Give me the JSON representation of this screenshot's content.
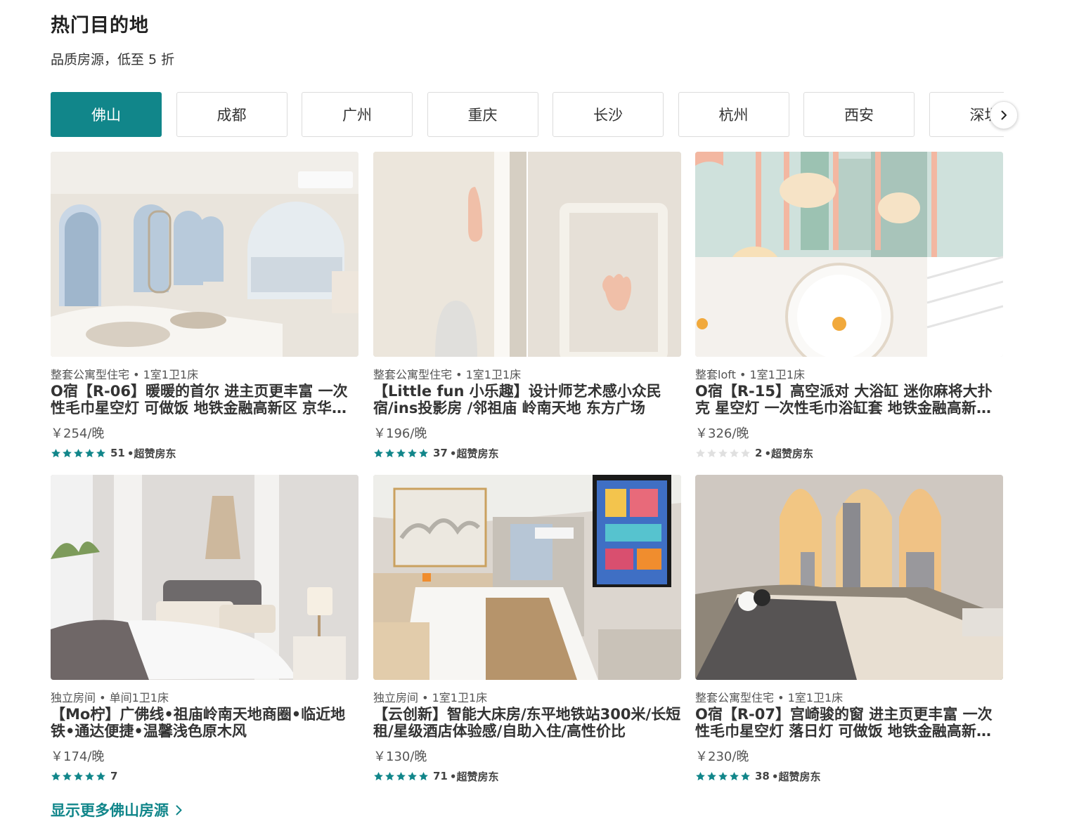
{
  "section": {
    "title": "热门目的地",
    "subtitle": "品质房源，低至 5 折"
  },
  "tabs": [
    {
      "label": "佛山",
      "active": true
    },
    {
      "label": "成都"
    },
    {
      "label": "广州"
    },
    {
      "label": "重庆"
    },
    {
      "label": "长沙"
    },
    {
      "label": "杭州"
    },
    {
      "label": "西安"
    },
    {
      "label": "深圳"
    }
  ],
  "next_icon": "chevron-right-icon",
  "listings": [
    {
      "meta": "整套公寓型住宅 • 1室1卫1床",
      "name": "O宿【R-06】暖暖的首尔 进主页更丰富 一次性毛巾星空灯 可做饭 地铁金融高新区 京华广场",
      "price": "￥254/晚",
      "rating": 5,
      "reviews": "51",
      "host_badge": "•超赞房东"
    },
    {
      "meta": "整套公寓型住宅 • 1室1卫1床",
      "name": "【Little fun 小乐趣】设计师艺术感小众民宿/ins投影房 /邻祖庙 岭南天地 东方广场",
      "price": "￥196/晚",
      "rating": 5,
      "reviews": "37",
      "host_badge": "•超赞房东"
    },
    {
      "meta": "整套loft • 1室1卫1床",
      "name": "O宿【R-15】高空派对 大浴缸 迷你麻将大扑克 星空灯 一次性毛巾浴缸套 地铁金融高新区京华广场",
      "price": "￥326/晚",
      "rating": 0,
      "reviews": "2",
      "host_badge": "•超赞房东"
    },
    {
      "meta": "独立房间 • 单间1卫1床",
      "name": "【Mo柠】广佛线•祖庙岭南天地商圈•临近地铁•通达便捷•温馨浅色原木风",
      "price": "￥174/晚",
      "rating": 5,
      "reviews": "7",
      "host_badge": ""
    },
    {
      "meta": "独立房间 • 1室1卫1床",
      "name": "【云创新】智能大床房/东平地铁站300米/长短租/星级酒店体验感/自助入住/高性价比",
      "price": "￥130/晚",
      "rating": 5,
      "reviews": "71",
      "host_badge": "•超赞房东"
    },
    {
      "meta": "整套公寓型住宅 • 1室1卫1床",
      "name": "O宿【R-07】宫崎骏的窗 进主页更丰富 一次性毛巾星空灯 落日灯 可做饭 地铁金融高新区 京华广场",
      "price": "￥230/晚",
      "rating": 5,
      "reviews": "38",
      "host_badge": "•超赞房东"
    }
  ],
  "more_link": {
    "label": "显示更多佛山房源",
    "icon": "chevron-right-icon"
  },
  "colors": {
    "accent": "#11868a",
    "star_filled": "#11868a",
    "star_empty": "#e0e0e0"
  }
}
